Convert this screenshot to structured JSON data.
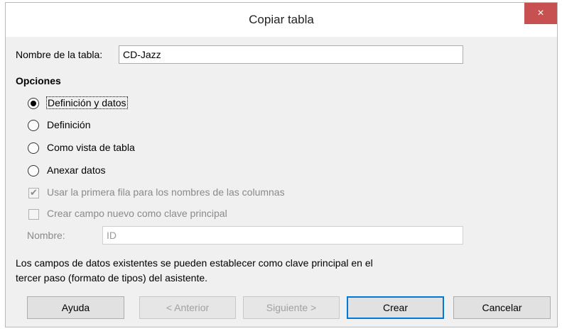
{
  "dialog": {
    "title": "Copiar tabla",
    "close_glyph": "×"
  },
  "table_name": {
    "label": "Nombre de la tabla:",
    "value": "CD-Jazz"
  },
  "options": {
    "heading": "Opciones",
    "radios": [
      {
        "label": "Definición y datos",
        "selected": true
      },
      {
        "label": "Definición",
        "selected": false
      },
      {
        "label": "Como vista de tabla",
        "selected": false
      },
      {
        "label": "Anexar datos",
        "selected": false
      }
    ],
    "use_first_row": {
      "label": "Usar la primera fila para los nombres de las columnas",
      "checked": true,
      "enabled": false
    },
    "create_pk": {
      "label": "Crear campo nuevo como clave principal",
      "checked": false,
      "enabled": false
    },
    "pk_name": {
      "label": "Nombre:",
      "value": "ID"
    }
  },
  "info_text": {
    "line1": "Los campos de datos existentes se pueden establecer como clave principal en el",
    "line2": "tercer paso (formato de tipos) del asistente."
  },
  "buttons": {
    "help": "Ayuda",
    "previous": "< Anterior",
    "next": "Siguiente >",
    "create": "Crear",
    "cancel": "Cancelar"
  },
  "colors": {
    "close_button": "#c75050",
    "default_button_border": "#0078d7"
  }
}
